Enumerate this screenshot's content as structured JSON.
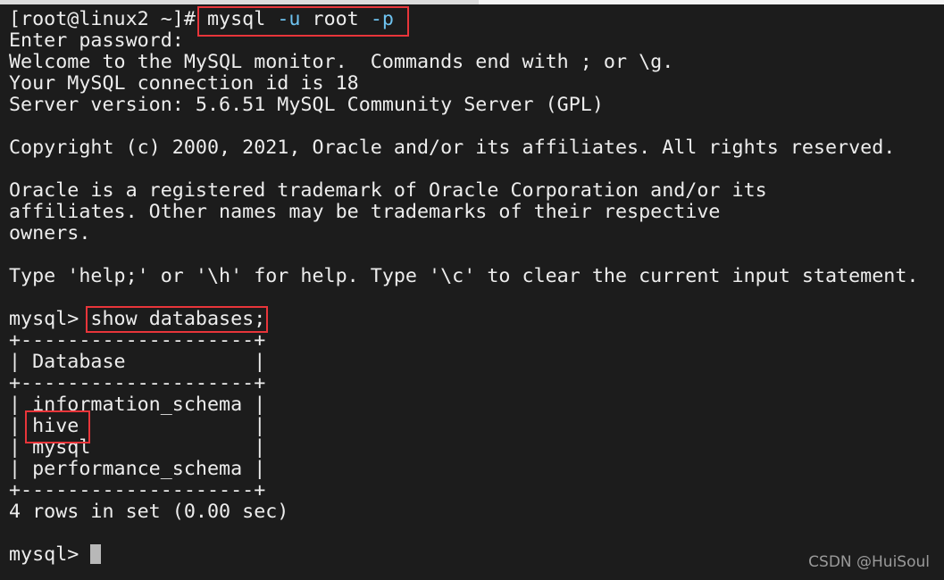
{
  "terminal": {
    "prompt_shell": "[root@linux2 ~]# ",
    "cmd_login": {
      "bin": "mysql",
      "flag_user": "-u",
      "user": "root",
      "flag_pass": "-p"
    },
    "enter_password": "Enter password:",
    "welcome": "Welcome to the MySQL monitor.  Commands end with ; or \\g.",
    "connection_id": "Your MySQL connection id is 18",
    "server_version": "Server version: 5.6.51 MySQL Community Server (GPL)",
    "copyright": "Copyright (c) 2000, 2021, Oracle and/or its affiliates. All rights reserved.",
    "trademark_lines": [
      "Oracle is a registered trademark of Oracle Corporation and/or its",
      "affiliates. Other names may be trademarks of their respective",
      "owners."
    ],
    "help_hint": "Type 'help;' or '\\h' for help. Type '\\c' to clear the current input statement.",
    "mysql_prompt": "mysql> ",
    "query": "show databases;",
    "table": {
      "border": "+--------------------+",
      "header": "| Database           |",
      "rows": [
        "| information_schema |",
        "| hive               |",
        "| mysql              |",
        "| performance_schema |"
      ]
    },
    "result_summary": "4 rows in set (0.00 sec)",
    "final_prompt": "mysql> "
  },
  "watermark": "CSDN @HuiSoul",
  "colors": {
    "background": "#1c1c1c",
    "text": "#ededed",
    "flag": "#6ec3f0",
    "highlight_box": "#e8353a",
    "cursor": "#b8b8b8"
  }
}
